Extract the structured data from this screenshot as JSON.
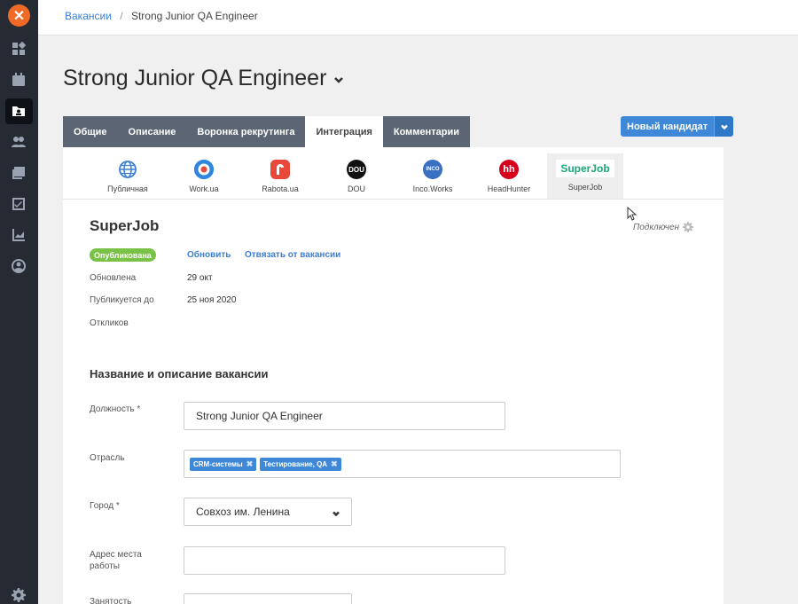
{
  "sidebar": {
    "logo": "✕",
    "icons": [
      "dashboard-icon",
      "calendar-icon",
      "vacancies-icon",
      "candidates-icon",
      "library-icon",
      "tasks-icon",
      "reports-icon",
      "profile-icon",
      "settings-icon"
    ]
  },
  "breadcrumb": {
    "parent": "Вакансии",
    "separator": "/",
    "current": "Strong Junior QA Engineer"
  },
  "page": {
    "title": "Strong Junior QA Engineer"
  },
  "tabs": [
    {
      "label": "Общие"
    },
    {
      "label": "Описание"
    },
    {
      "label": "Воронка рекрутинга"
    },
    {
      "label": "Интеграция",
      "active": true
    },
    {
      "label": "Комментарии"
    }
  ],
  "new_candidate": {
    "label": "Новый кандидат"
  },
  "integrations": [
    {
      "label": "Публичная",
      "icon": "globe-icon",
      "color": "#3d7fd8"
    },
    {
      "label": "Work.ua",
      "icon": "workua-icon",
      "color": "#2f86e0"
    },
    {
      "label": "Rabota.ua",
      "icon": "rabotaua-icon",
      "color": "#e8493b"
    },
    {
      "label": "DOU",
      "icon": "dou-icon",
      "color": "#111111",
      "text": "DOU"
    },
    {
      "label": "Inco.Works",
      "icon": "incoworks-icon",
      "color": "#3a6fc4",
      "text": "INCO"
    },
    {
      "label": "HeadHunter",
      "icon": "headhunter-icon",
      "color": "#d6001c",
      "text": "hh"
    },
    {
      "label": "SuperJob",
      "icon": "superjob-icon",
      "text": "SuperJob",
      "active": true
    }
  ],
  "integration_detail": {
    "title": "SuperJob",
    "connected_label": "Подключен",
    "status_badge": "Опубликована",
    "refresh_link": "Обновить",
    "unlink_link": "Отвязать от вакансии",
    "updated_label": "Обновлена",
    "updated_value": "29 окт",
    "published_until_label": "Публикуется до",
    "published_until_value": "25 ноя 2020",
    "responses_label": "Откликов"
  },
  "form": {
    "section_title": "Название и описание вакансии",
    "position_label": "Должность *",
    "position_value": "Strong Junior QA Engineer",
    "industry_label": "Отрасль",
    "industry_tags": [
      "CRM-системы",
      "Тестирование, QA"
    ],
    "city_label": "Город *",
    "city_value": "Совхоз им. Ленина",
    "address_label_1": "Адрес места",
    "address_label_2": "работы",
    "employment_label": "Занятость"
  }
}
